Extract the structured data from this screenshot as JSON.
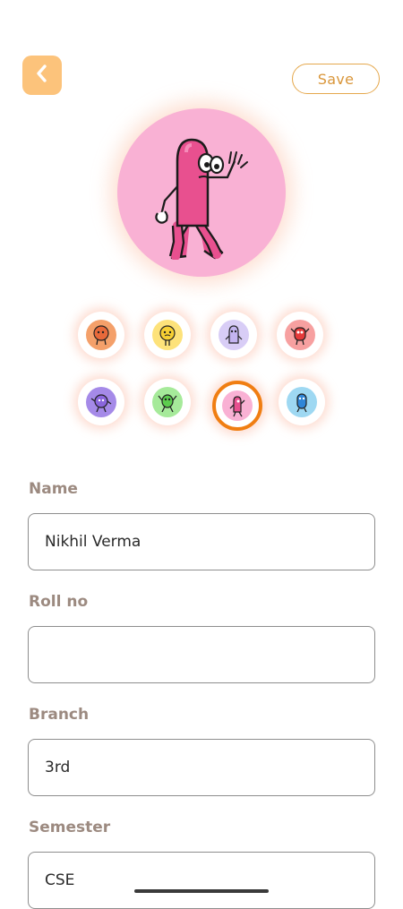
{
  "header": {
    "back_icon": "chevron-left-icon",
    "save_label": "Save",
    "accent_color": "#fcc37b"
  },
  "avatar": {
    "selected": "pink-character",
    "background": "#f9b1d4"
  },
  "avatar_options": [
    {
      "name": "orange-character",
      "color": "#f4a06a",
      "selected": false
    },
    {
      "name": "yellow-character",
      "color": "#fde27a",
      "selected": false
    },
    {
      "name": "lavender-character",
      "color": "#d8cdf6",
      "selected": false
    },
    {
      "name": "red-character",
      "color": "#f7a0a0",
      "selected": false
    },
    {
      "name": "purple-character",
      "color": "#a58ae8",
      "selected": false
    },
    {
      "name": "green-character",
      "color": "#a6ea9a",
      "selected": false
    },
    {
      "name": "pink-character",
      "color": "#f9b1d4",
      "selected": true
    },
    {
      "name": "blue-character",
      "color": "#9ed8f2",
      "selected": false
    }
  ],
  "form": {
    "name": {
      "label": "Name",
      "value": "Nikhil Verma"
    },
    "roll_no": {
      "label": "Roll no",
      "value": ""
    },
    "branch": {
      "label": "Branch",
      "value": "3rd"
    },
    "semester": {
      "label": "Semester",
      "value": "CSE"
    }
  }
}
